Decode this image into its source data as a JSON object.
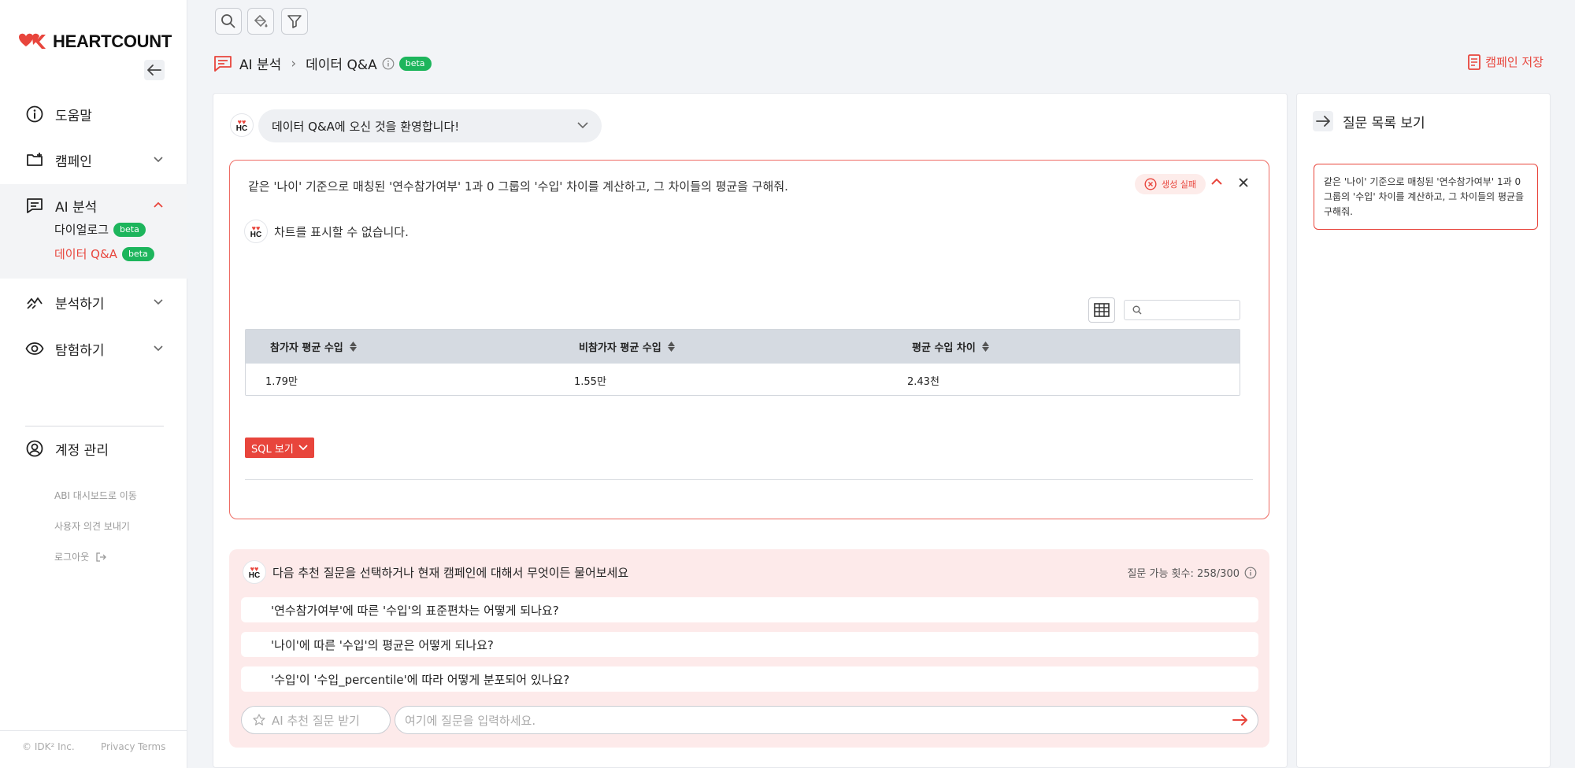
{
  "app": {
    "logo_text": "HEARTCOUNT"
  },
  "sidebar": {
    "items": [
      {
        "label": "도움말",
        "icon": "info-icon"
      },
      {
        "label": "캠페인",
        "icon": "folder-plus-icon"
      },
      {
        "label": "AI 분석",
        "icon": "chat-icon",
        "expanded": true,
        "children": [
          {
            "label": "다이얼로그",
            "badge": "beta"
          },
          {
            "label": "데이터 Q&A",
            "badge": "beta",
            "active": true
          }
        ]
      },
      {
        "label": "분석하기",
        "icon": "analytics-icon"
      },
      {
        "label": "탐험하기",
        "icon": "eye-icon"
      }
    ],
    "account": {
      "label": "계정 관리",
      "icon": "user-circle-icon"
    },
    "links": [
      "ABI 대시보드로 이동",
      "사용자 의견 보내기",
      "로그아웃"
    ],
    "footer": {
      "copyright": "© IDK² Inc.",
      "privacy": "Privacy",
      "terms": "Terms"
    }
  },
  "toolbar": {
    "icons": [
      "search-icon",
      "paint-bucket-icon",
      "filter-icon"
    ]
  },
  "breadcrumb": {
    "section": "AI 분석",
    "page": "데이터 Q&A",
    "badge": "beta"
  },
  "save_campaign": {
    "label": "캠페인 저장"
  },
  "welcome": {
    "text": "데이터 Q&A에 오신 것을 환영합니다!"
  },
  "result": {
    "question": "같은 '나이' 기준으로 매칭된 '연수참가여부' 1과 0 그룹의 '수입' 차이를 계산하고, 그 차이들의 평균을 구해줘.",
    "status": "생성 실패",
    "answer": "차트를 표시할 수 없습니다.",
    "table": {
      "columns": [
        "참가자 평균 수입",
        "비참가자 평균 수입",
        "평균 수입 차이"
      ],
      "rows": [
        [
          "1.79만",
          "1.55만",
          "2.43천"
        ]
      ]
    },
    "sql_button": "SQL 보기"
  },
  "suggestions": {
    "header": "다음 추천 질문을 선택하거나 현재 캠페인에 대해서 무엇이든 물어보세요",
    "quota_label": "질문 가능 횟수: 258/300",
    "items": [
      "'연수참가여부'에 따른 '수입'의 표준편차는 어떻게 되나요?",
      "'나이'에 따른 '수입'의 평균은 어떻게 되나요?",
      "'수입'이 '수입_percentile'에 따라 어떻게 분포되어 있나요?"
    ],
    "ai_suggest_button": "AI 추천 질문 받기",
    "input_placeholder": "여기에 질문을 입력하세요."
  },
  "right_panel": {
    "title": "질문 목록 보기",
    "history": [
      "같은 '나이' 기준으로 매칭된 '연수참가여부' 1과 0 그룹의 '수입' 차이를 계산하고, 그 차이들의 평균을 구해줘."
    ]
  },
  "colors": {
    "accent": "#e8453c",
    "beta": "#1db55c",
    "background": "#f2f4f7",
    "suggest_bg": "#fdeaea"
  }
}
